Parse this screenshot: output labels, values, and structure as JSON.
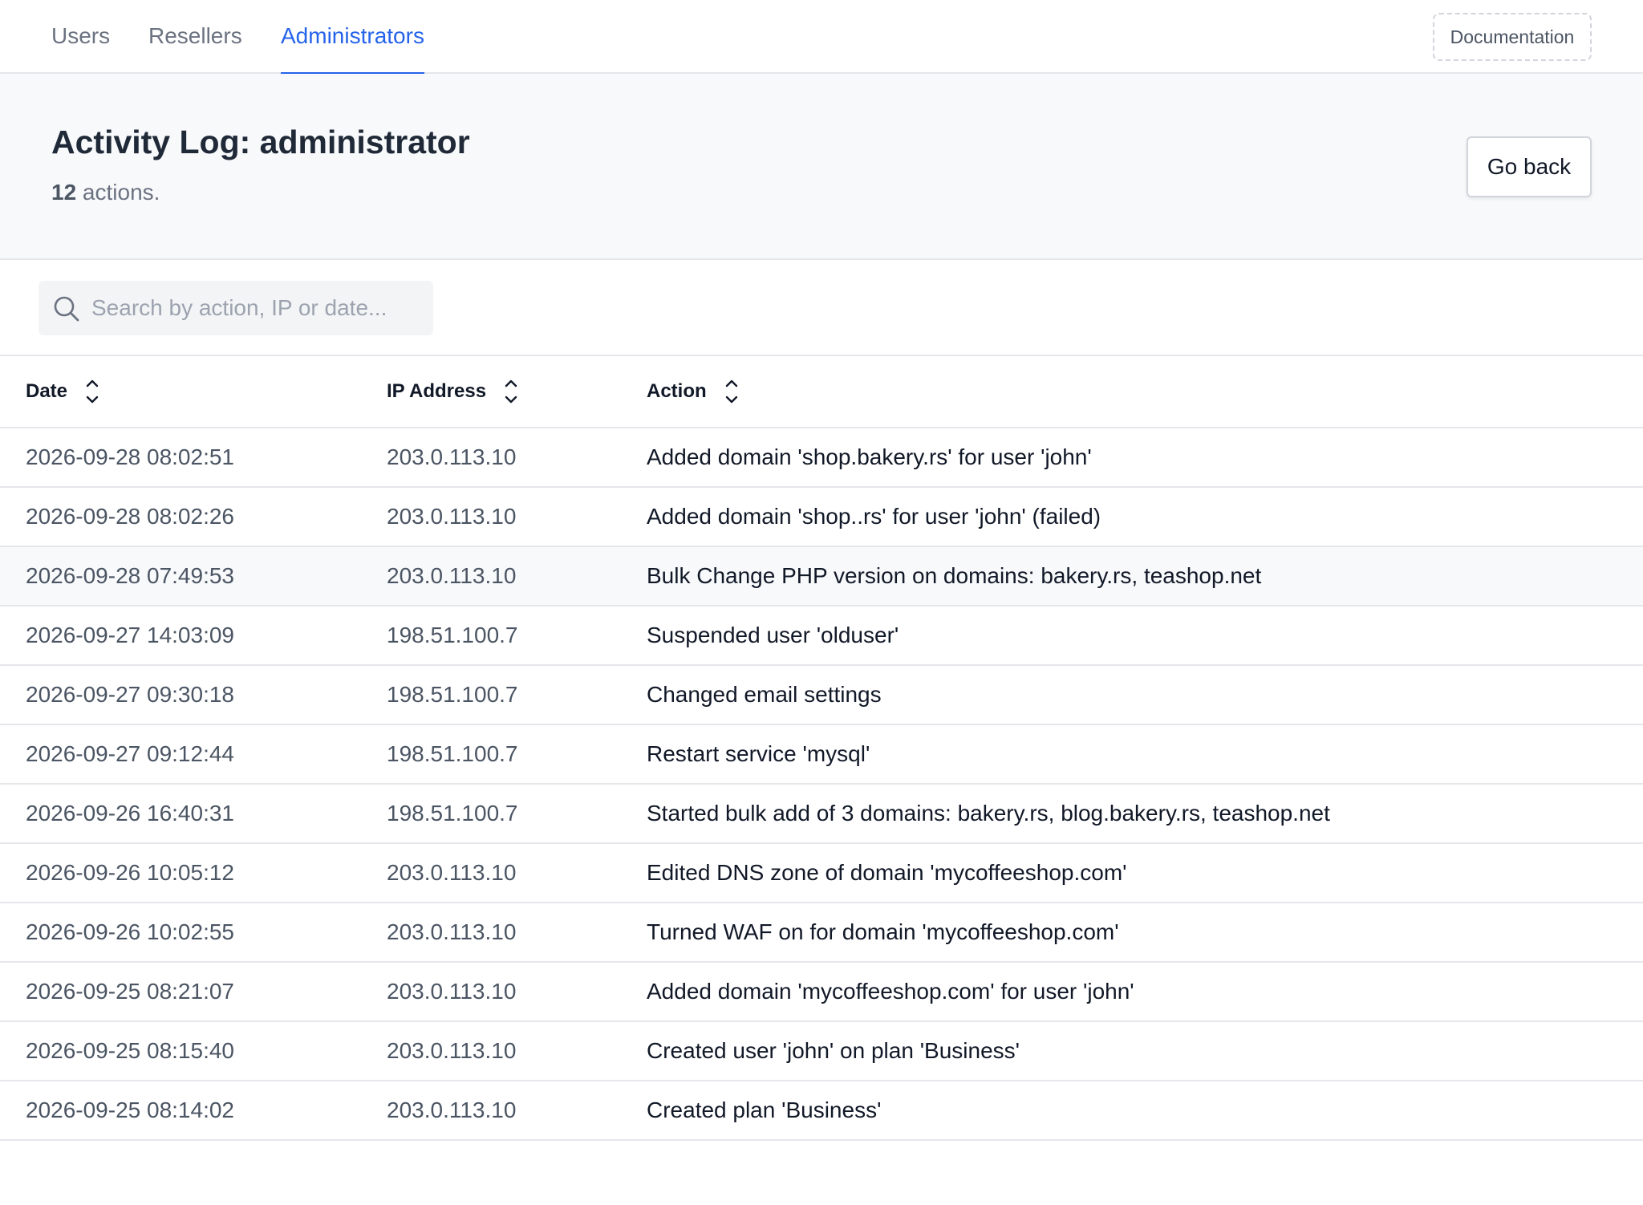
{
  "nav": {
    "tabs": [
      {
        "label": "Users"
      },
      {
        "label": "Resellers"
      },
      {
        "label": "Administrators"
      }
    ],
    "active_tab": "Administrators",
    "documentation_label": "Documentation",
    "accent_color": "#2563eb"
  },
  "header": {
    "title": "Activity Log: administrator",
    "count": "12",
    "count_suffix": " actions.",
    "go_back_label": "Go back"
  },
  "search": {
    "placeholder": "Search by action, IP or date...",
    "value": ""
  },
  "table": {
    "columns": [
      {
        "label": "Date"
      },
      {
        "label": "IP Address"
      },
      {
        "label": "Action"
      }
    ],
    "highlighted_row": 3,
    "rows": [
      {
        "date": "2026-09-28 08:02:51",
        "ip": "203.0.113.10",
        "action": "Added domain 'shop.bakery.rs' for user 'john'"
      },
      {
        "date": "2026-09-28 08:02:26",
        "ip": "203.0.113.10",
        "action": "Added domain 'shop..rs' for user 'john' (failed)"
      },
      {
        "date": "2026-09-28 07:49:53",
        "ip": "203.0.113.10",
        "action": "Bulk Change PHP version on domains: bakery.rs, teashop.net"
      },
      {
        "date": "2026-09-27 14:03:09",
        "ip": "198.51.100.7",
        "action": "Suspended user 'olduser'"
      },
      {
        "date": "2026-09-27 09:30:18",
        "ip": "198.51.100.7",
        "action": "Changed email settings"
      },
      {
        "date": "2026-09-27 09:12:44",
        "ip": "198.51.100.7",
        "action": "Restart service 'mysql'"
      },
      {
        "date": "2026-09-26 16:40:31",
        "ip": "198.51.100.7",
        "action": "Started bulk add of 3 domains: bakery.rs, blog.bakery.rs, teashop.net"
      },
      {
        "date": "2026-09-26 10:05:12",
        "ip": "203.0.113.10",
        "action": "Edited DNS zone of domain 'mycoffeeshop.com'"
      },
      {
        "date": "2026-09-26 10:02:55",
        "ip": "203.0.113.10",
        "action": "Turned WAF on for domain 'mycoffeeshop.com'"
      },
      {
        "date": "2026-09-25 08:21:07",
        "ip": "203.0.113.10",
        "action": "Added domain 'mycoffeeshop.com' for user 'john'"
      },
      {
        "date": "2026-09-25 08:15:40",
        "ip": "203.0.113.10",
        "action": "Created user 'john' on plan 'Business'"
      },
      {
        "date": "2026-09-25 08:14:02",
        "ip": "203.0.113.10",
        "action": "Created plan 'Business'"
      }
    ]
  }
}
